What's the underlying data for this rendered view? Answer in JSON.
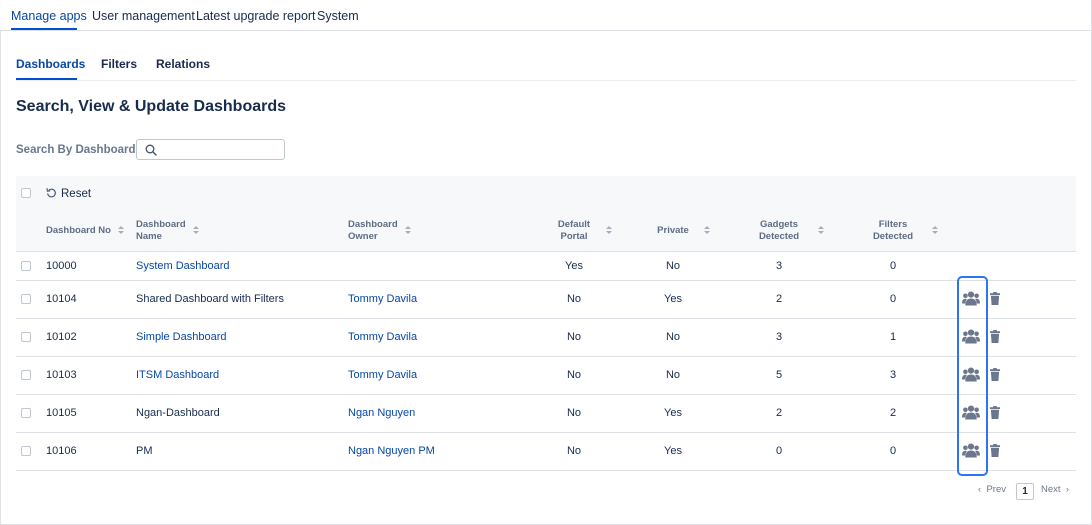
{
  "top_nav": {
    "tabs": [
      {
        "label": "Manage apps",
        "active": true
      },
      {
        "label": "User management",
        "active": false
      },
      {
        "label": "Latest upgrade report",
        "active": false
      },
      {
        "label": "System",
        "active": false
      }
    ]
  },
  "sub_tabs": [
    {
      "label": "Dashboards",
      "active": true
    },
    {
      "label": "Filters",
      "active": false
    },
    {
      "label": "Relations",
      "active": false
    }
  ],
  "page_title": "Search, View & Update Dashboards",
  "search": {
    "label": "Search By Dashboard",
    "value": "",
    "placeholder": "",
    "icon": "search-icon"
  },
  "toolbar": {
    "reset_label": "Reset",
    "reset_icon": "undo-icon"
  },
  "table": {
    "headers": {
      "no": [
        "Dashboard No"
      ],
      "name": [
        "Dashboard",
        "Name"
      ],
      "owner": [
        "Dashboard",
        "Owner"
      ],
      "portal": [
        "Default",
        "Portal"
      ],
      "private": [
        "Private"
      ],
      "gadgets": [
        "Gadgets",
        "Detected"
      ],
      "filters": [
        "Filters",
        "Detected"
      ]
    },
    "rows": [
      {
        "no": "10000",
        "name": "System Dashboard",
        "name_link": true,
        "owner": "",
        "portal": "Yes",
        "private": "No",
        "gadgets": "3",
        "filters": "0",
        "actions": false
      },
      {
        "no": "10104",
        "name": "Shared Dashboard with Filters",
        "name_link": false,
        "owner": "Tommy Davila",
        "portal": "No",
        "private": "Yes",
        "gadgets": "2",
        "filters": "0",
        "actions": true
      },
      {
        "no": "10102",
        "name": "Simple Dashboard",
        "name_link": true,
        "owner": "Tommy Davila",
        "portal": "No",
        "private": "No",
        "gadgets": "3",
        "filters": "1",
        "actions": true
      },
      {
        "no": "10103",
        "name": "ITSM Dashboard",
        "name_link": true,
        "owner": "Tommy Davila",
        "portal": "No",
        "private": "No",
        "gadgets": "5",
        "filters": "3",
        "actions": true
      },
      {
        "no": "10105",
        "name": "Ngan-Dashboard",
        "name_link": false,
        "owner": "Ngan Nguyen",
        "portal": "No",
        "private": "Yes",
        "gadgets": "2",
        "filters": "2",
        "actions": true
      },
      {
        "no": "10106",
        "name": "PM",
        "name_link": false,
        "owner": "Ngan Nguyen PM",
        "portal": "No",
        "private": "Yes",
        "gadgets": "0",
        "filters": "0",
        "actions": true
      }
    ],
    "action_icons": [
      "users-icon",
      "trash-icon"
    ]
  },
  "pagination": {
    "prev_label": "Prev",
    "next_label": "Next",
    "current_page": "1"
  },
  "colors": {
    "link": "#0747a6",
    "accent": "#0052cc",
    "highlight": "#2d74f0",
    "icon": "#6b778c"
  }
}
